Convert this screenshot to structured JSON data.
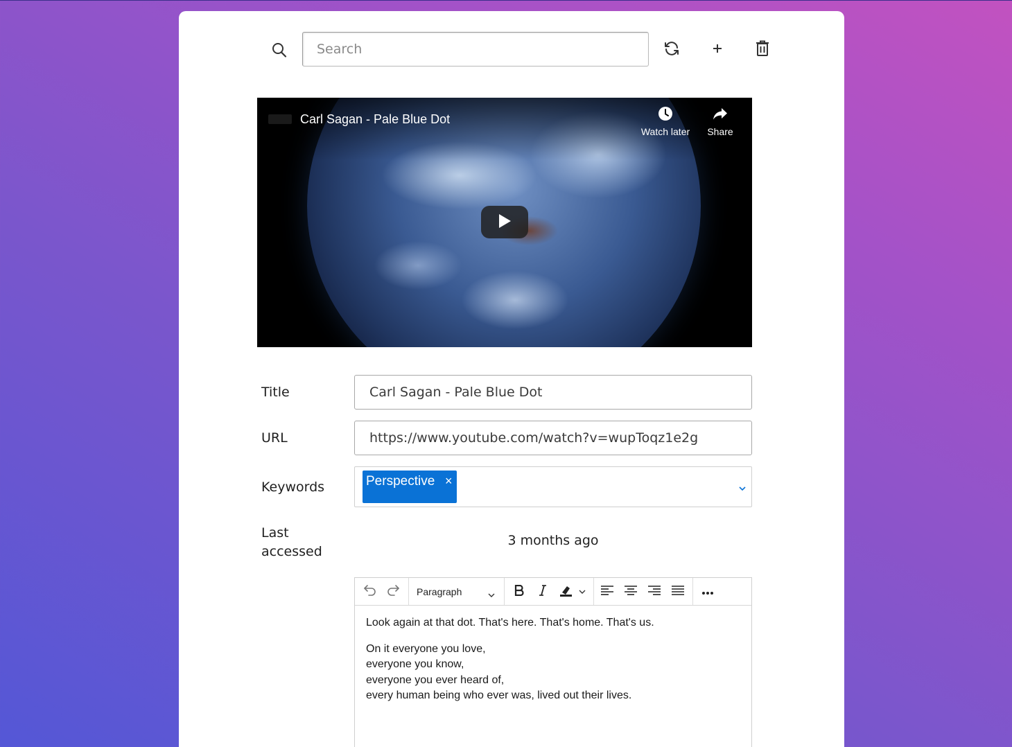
{
  "search": {
    "placeholder": "Search"
  },
  "toolbar": {
    "refresh_icon": "refresh-icon",
    "add_icon": "plus-icon",
    "delete_icon": "trash-icon"
  },
  "video": {
    "title": "Carl Sagan - Pale Blue Dot",
    "watch_later_label": "Watch later",
    "share_label": "Share"
  },
  "form": {
    "title_label": "Title",
    "title_value": "Carl Sagan - Pale Blue Dot",
    "url_label": "URL",
    "url_value": "https://www.youtube.com/watch?v=wupToqz1e2g",
    "keywords_label": "Keywords",
    "keywords": [
      "Perspective"
    ],
    "tag_remove": "×",
    "last_accessed_label": "Last accessed",
    "last_accessed_value": "3 months ago"
  },
  "editor": {
    "format": "Paragraph",
    "paragraph1": "Look again at that dot. That's here. That's home. That's us.",
    "lines": [
      "On it everyone you love,",
      "everyone you know,",
      "everyone you ever heard of,",
      "every human being who ever was, lived out their lives."
    ]
  },
  "colors": {
    "accent": "#0a72d6",
    "card": "#ffffff"
  }
}
